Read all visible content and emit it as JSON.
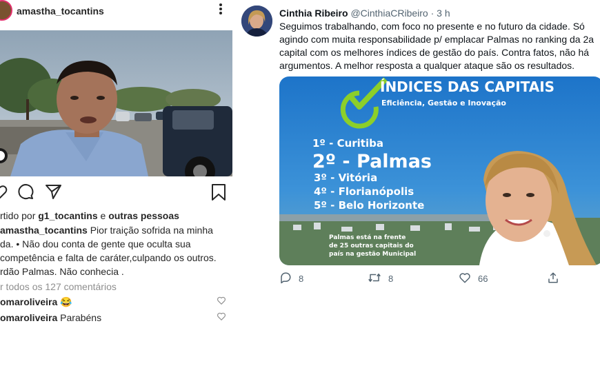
{
  "instagram": {
    "username": "amastha_tocantins",
    "more_icon": "more-vertical-icon",
    "icons": [
      "heart-icon",
      "comment-icon",
      "share-icon",
      "bookmark-icon"
    ],
    "shared_prefix": "rtido por",
    "shared_user": "g1_tocantins",
    "shared_joiner": "e",
    "shared_others": "outras pessoas",
    "caption_user": "amastha_tocantins",
    "caption_lines": [
      "Pior traição sofrida na minha",
      "da. • Não dou conta de gente que oculta sua",
      "competência e falta de caráter,culpando os outros.",
      "rdão Palmas. Não conhecia ."
    ],
    "view_comments": "r todos os 127 comentários",
    "comments": [
      {
        "user": "omaroliveira",
        "text": "😂"
      },
      {
        "user": "omaroliveira",
        "text": "Parabéns"
      }
    ]
  },
  "twitter": {
    "name": "Cinthia Ribeiro",
    "handle": "@CinthiaCRibeiro",
    "time": "· 3 h",
    "text": "Seguimos trabalhando, com foco no presente e no futuro da cidade. Só agindo com muita responsabilidade p/ emplacar Palmas no ranking da 2a capital com os melhores índices de gestão do país. Contra fatos, não há argumentos. A melhor resposta a qualquer ataque são os resultados.",
    "media": {
      "title": "ÍNDICES DAS CAPITAIS",
      "subtitle": "Eficiência, Gestão e Inovação",
      "ranking": [
        "1º - Curitiba",
        "2º - Palmas",
        "3º - Vitória",
        "4º - Florianópolis",
        "5º - Belo Horizonte"
      ],
      "footer_lines": [
        "Palmas está na frente",
        "de 25 outras capitais do",
        "país na gestão Municipal"
      ],
      "accent": "#8ccf2a"
    },
    "actions": {
      "replies": "8",
      "retweets": "8",
      "likes": "66"
    }
  }
}
